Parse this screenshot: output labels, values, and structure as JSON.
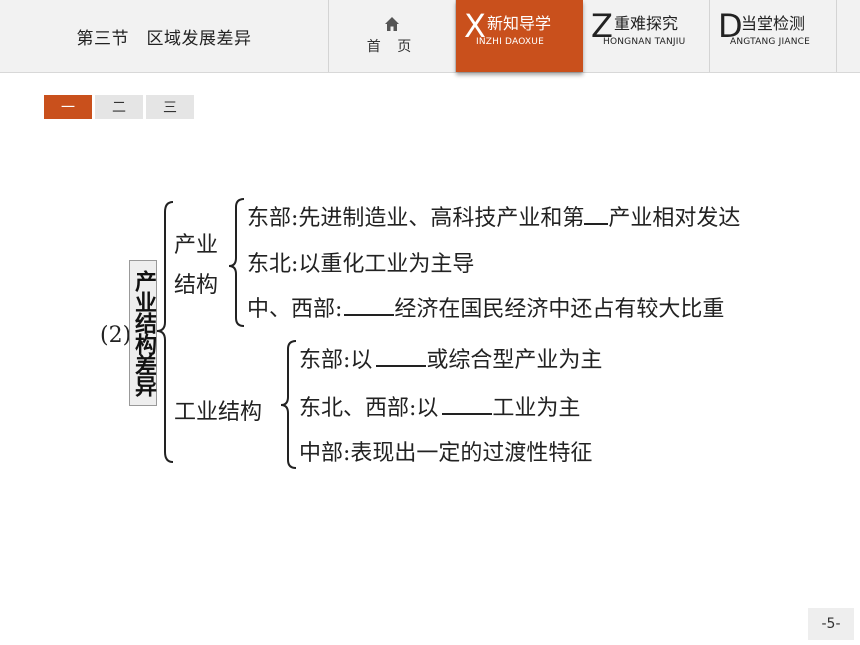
{
  "header": {
    "section_title": "第三节　区域发展差异",
    "home": {
      "icon": "home-icon",
      "label": "首 页"
    },
    "tabs": [
      {
        "letter": "X",
        "title": "新知导学",
        "subtitle": "INZHI DAOXUE",
        "active": true
      },
      {
        "letter": "Z",
        "title": "重难探究",
        "subtitle": "HONGNAN TANJIU",
        "active": false
      },
      {
        "letter": "D",
        "title": "当堂检测",
        "subtitle": "ANGTANG JIANCE",
        "active": false
      }
    ],
    "accent_color": "#c9501c"
  },
  "subtabs": [
    {
      "label": "一",
      "active": true
    },
    {
      "label": "二",
      "active": false
    },
    {
      "label": "三",
      "active": false
    }
  ],
  "diagram": {
    "number": "(2)",
    "root": "产业结构差异",
    "branches": [
      {
        "label_line1": "产业",
        "label_line2": "结构",
        "items": [
          {
            "before": "东部:先进制造业、高科技产业和第",
            "after": "产业相对发达"
          },
          {
            "text": "东北:以重化工业为主导"
          },
          {
            "before": "中、西部:",
            "after": "经济在国民经济中还占有较大比重"
          }
        ]
      },
      {
        "label": "工业结构",
        "items": [
          {
            "before": "东部:以",
            "after": "或综合型产业为主"
          },
          {
            "before": "东北、西部:以",
            "after": "工业为主"
          },
          {
            "text": "中部:表现出一定的过渡性特征"
          }
        ]
      }
    ]
  },
  "page_number": "-5-"
}
